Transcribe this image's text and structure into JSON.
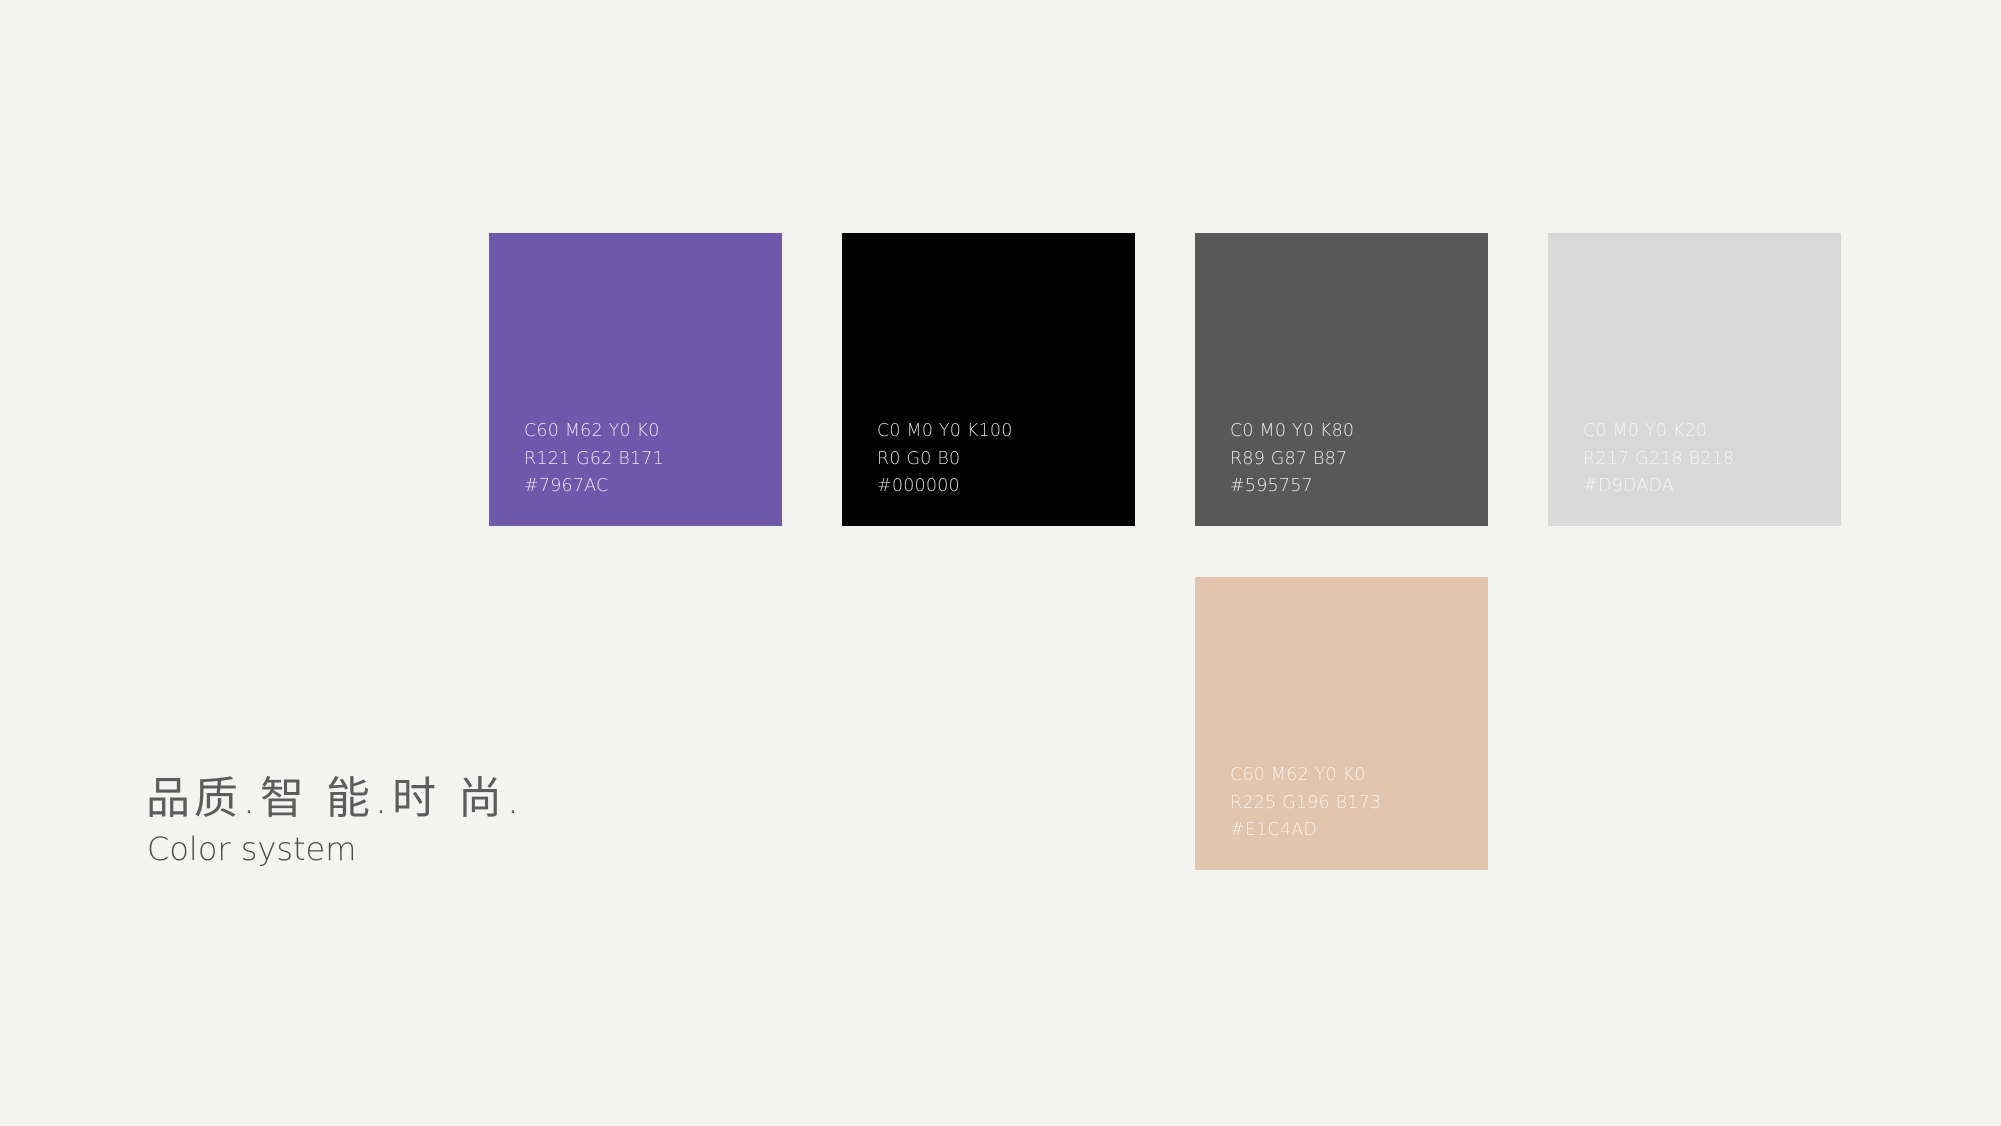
{
  "heading": {
    "tagline": "品质.智 能.时 尚.",
    "subtitle": "Color system"
  },
  "swatches": [
    {
      "color": "#6E58AB",
      "text_color": "#e9e4f4",
      "cmyk": "C60 M62 Y0 K0",
      "rgb": "R121 G62 B171",
      "hex": "#7967AC"
    },
    {
      "color": "#000000",
      "text_color": "#d9d9d9",
      "cmyk": "C0 M0 Y0 K100",
      "rgb": "R0 G0 B0",
      "hex": "#000000"
    },
    {
      "color": "#595858",
      "text_color": "#ececec",
      "cmyk": "C0 M0 Y0 K80",
      "rgb": "R89 G87 B87",
      "hex": "#595757"
    },
    {
      "color": "#D9D9D9",
      "text_color": "#f4f4f4",
      "cmyk": "C0 M0 Y0 K20",
      "rgb": "R217 G218 B218",
      "hex": "#D9DADA"
    },
    {
      "color": "#E1C4AE",
      "text_color": "#faf1ea",
      "cmyk": "C60 M62 Y0 K0",
      "rgb": "R225 G196 B173",
      "hex": "#E1C4AD"
    }
  ]
}
